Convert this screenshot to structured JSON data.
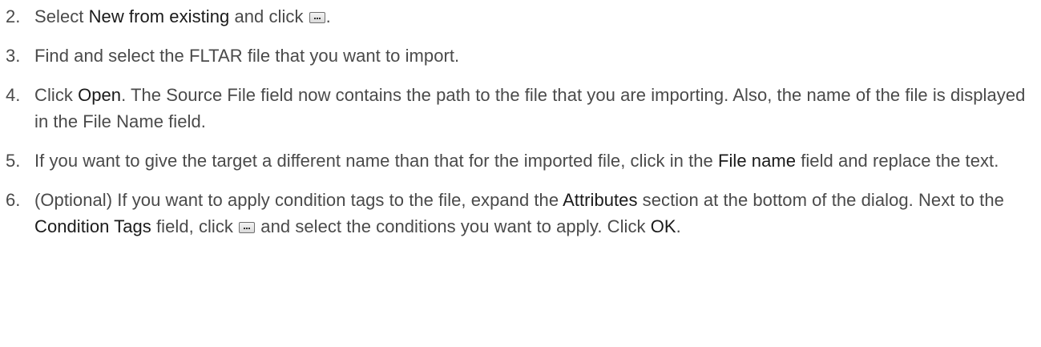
{
  "steps": [
    {
      "number": "2.",
      "parts": [
        "Select ",
        "New from existing",
        " and click ",
        "."
      ]
    },
    {
      "number": "3.",
      "text": "Find and select the FLTAR file that you want to import."
    },
    {
      "number": "4.",
      "parts": [
        "Click ",
        "Open",
        ". The Source File field now contains the path to the file that you are importing. Also, the name of the file is displayed in the File Name field."
      ]
    },
    {
      "number": "5.",
      "parts": [
        "If you want to give the target a different name than that for the imported file, click in the ",
        "File name",
        " field and replace the text."
      ]
    },
    {
      "number": "6.",
      "parts": [
        "(Optional) If you want to apply condition tags to the file, expand the ",
        "Attributes",
        " section at the bottom of the dialog. Next to the ",
        "Condition Tags",
        " field, click ",
        " and select the conditions you want to apply. Click ",
        "OK",
        "."
      ]
    }
  ],
  "icons": {
    "browse_button_icon": "ellipsis-browse-icon"
  }
}
